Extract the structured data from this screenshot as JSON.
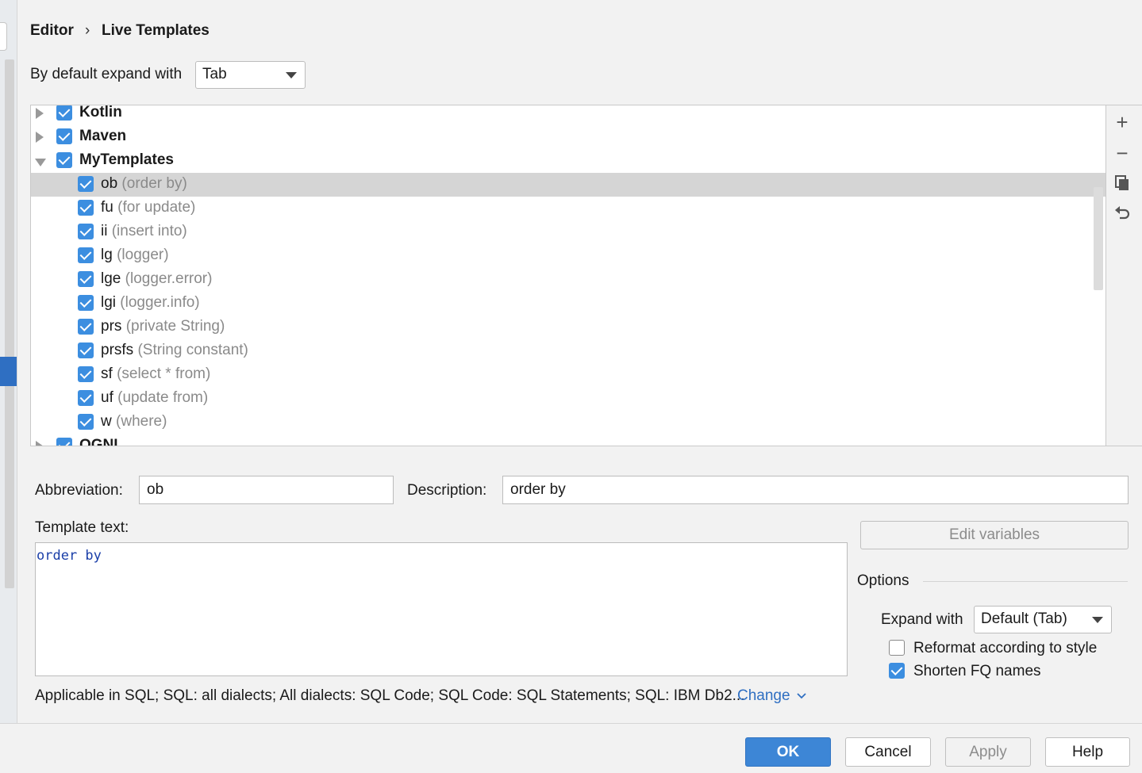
{
  "breadcrumb": {
    "parent": "Editor",
    "separator": "›",
    "current": "Live Templates"
  },
  "expand_default": {
    "label": "By default expand with",
    "value": "Tab"
  },
  "tree": {
    "groups": [
      {
        "name": "Kotlin",
        "expanded": false,
        "checked": true
      },
      {
        "name": "Maven",
        "expanded": false,
        "checked": true
      },
      {
        "name": "MyTemplates",
        "expanded": true,
        "checked": true,
        "items": [
          {
            "abbr": "ob",
            "desc": "(order by)",
            "checked": true,
            "selected": true
          },
          {
            "abbr": "fu",
            "desc": "(for update)",
            "checked": true
          },
          {
            "abbr": "ii",
            "desc": "(insert into)",
            "checked": true
          },
          {
            "abbr": "lg",
            "desc": "(logger)",
            "checked": true
          },
          {
            "abbr": "lge",
            "desc": "(logger.error)",
            "checked": true
          },
          {
            "abbr": "lgi",
            "desc": "(logger.info)",
            "checked": true
          },
          {
            "abbr": "prs",
            "desc": "(private String)",
            "checked": true
          },
          {
            "abbr": "prsfs",
            "desc": "(String constant)",
            "checked": true
          },
          {
            "abbr": "sf",
            "desc": "(select * from)",
            "checked": true
          },
          {
            "abbr": "uf",
            "desc": "(update from)",
            "checked": true
          },
          {
            "abbr": "w",
            "desc": "(where)",
            "checked": true
          }
        ]
      },
      {
        "name": "OGNL",
        "expanded": false,
        "checked": true
      }
    ]
  },
  "toolbar": {
    "add_icon": "plus-icon",
    "remove_icon": "minus-icon",
    "copy_icon": "copy-icon",
    "restore_icon": "undo-icon"
  },
  "form": {
    "abbreviation_label": "Abbreviation:",
    "abbreviation_value": "ob",
    "description_label": "Description:",
    "description_value": "order by",
    "template_text_label": "Template text:",
    "template_text_value": "order by",
    "edit_variables": "Edit variables",
    "applicable": "Applicable in SQL; SQL: all dialects; All dialects: SQL Code; SQL Code: SQL Statements; SQL: IBM Db2...",
    "change_link": "Change"
  },
  "options": {
    "title": "Options",
    "expand_label": "Expand with",
    "expand_value": "Default (Tab)",
    "reformat_label": "Reformat according to style",
    "reformat_checked": false,
    "shorten_label": "Shorten FQ names",
    "shorten_checked": true
  },
  "buttons": {
    "ok": "OK",
    "cancel": "Cancel",
    "apply": "Apply",
    "help": "Help"
  },
  "colors": {
    "accent": "#3c8ee0",
    "primary_button": "#3d86d6",
    "link": "#2f6fc2",
    "template_code": "#1b3fa8",
    "selection": "#d5d5d5"
  }
}
